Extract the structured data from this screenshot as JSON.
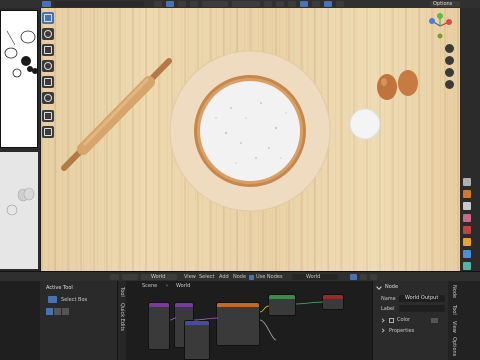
{
  "topbar": {
    "options_label": "Options"
  },
  "node_header": {
    "world_dropdown": "World",
    "menus": [
      "View",
      "Select",
      "Add",
      "Node"
    ],
    "use_nodes_label": "Use Nodes",
    "world_field": "World"
  },
  "breadcrumb": {
    "scene": "Scene",
    "world": "World"
  },
  "active_tool": {
    "title": "Active Tool",
    "tool_name": "Select Box"
  },
  "side_tabs": {
    "tool": "Tool",
    "quick_edits": "Quick Edits"
  },
  "panel": {
    "node_title": "Node",
    "name_label": "Name",
    "name_value": "World Output",
    "label_label": "Label",
    "label_value": "",
    "color_label": "Color",
    "properties_label": "Properties"
  },
  "right_tabs": [
    "Node",
    "Tool",
    "View",
    "Options"
  ],
  "colors": {
    "selection_blue": "#4772b3",
    "wood": "#e9d2a6",
    "node_header_shader": "#3d8a4a"
  }
}
